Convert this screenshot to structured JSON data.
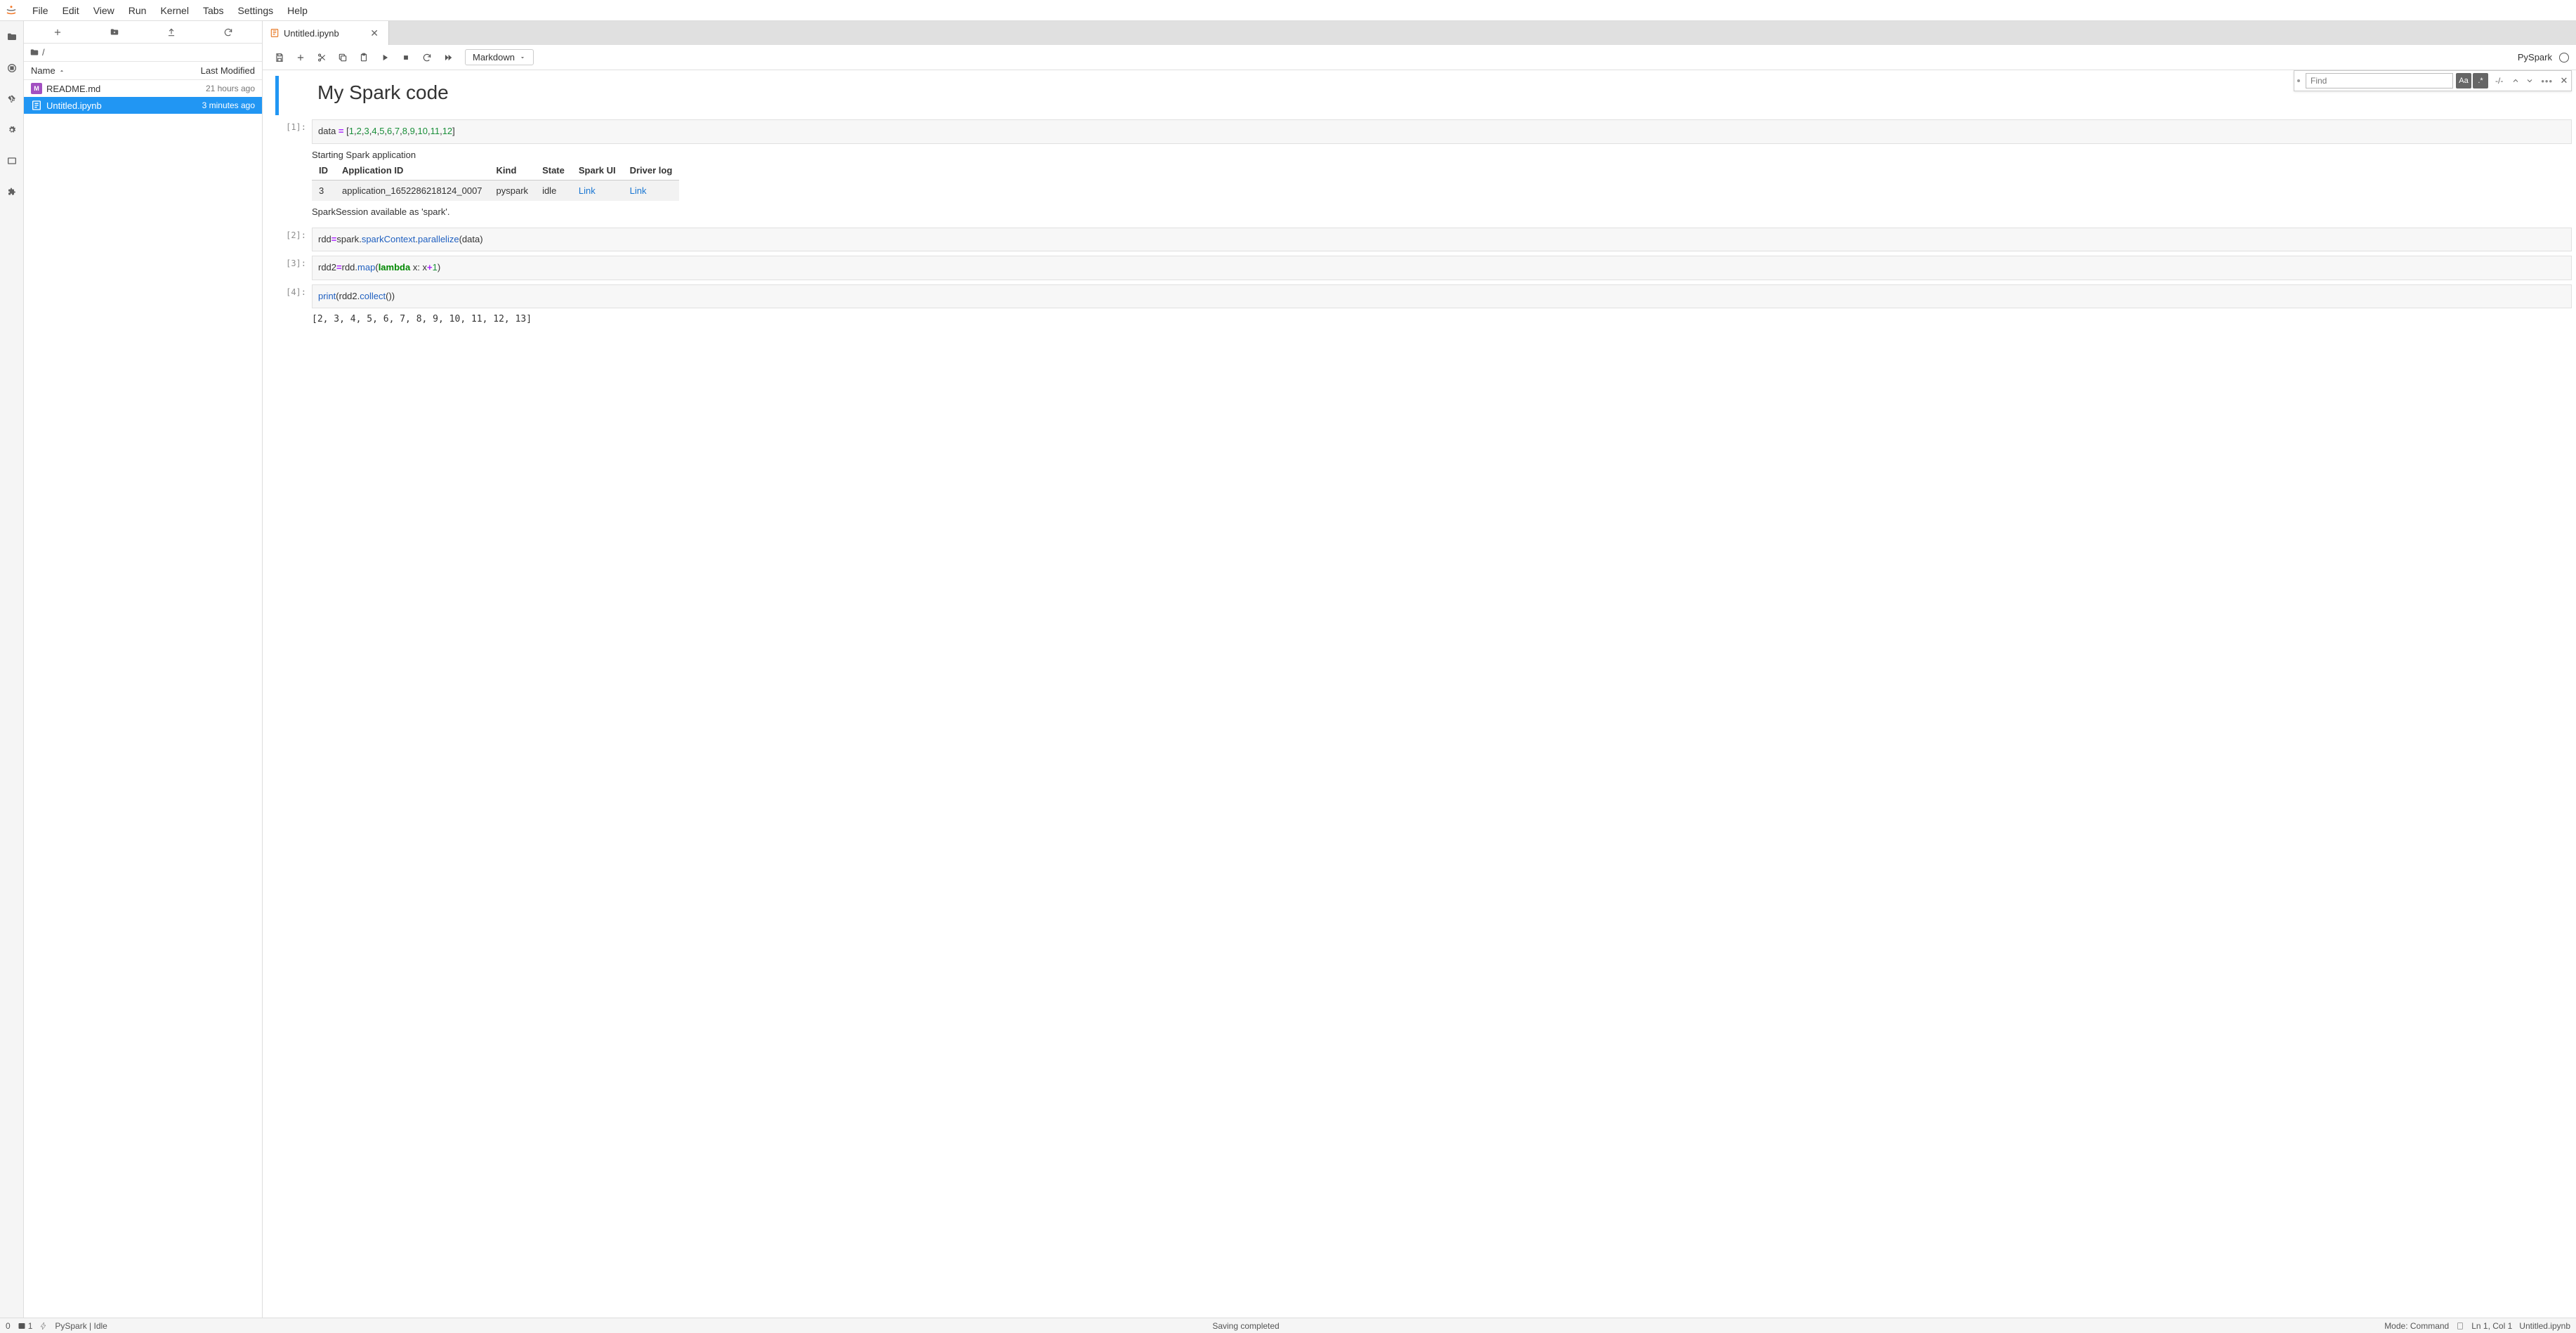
{
  "menu": [
    "File",
    "Edit",
    "View",
    "Run",
    "Kernel",
    "Tabs",
    "Settings",
    "Help"
  ],
  "file_toolbar": {
    "breadcrumb_sep": "/"
  },
  "file_header": {
    "name": "Name",
    "modified": "Last Modified"
  },
  "files": [
    {
      "name": "README.md",
      "modified": "21 hours ago",
      "icon": "md",
      "selected": false,
      "badge": "M"
    },
    {
      "name": "Untitled.ipynb",
      "modified": "3 minutes ago",
      "icon": "nb",
      "selected": true
    }
  ],
  "tab": {
    "title": "Untitled.ipynb"
  },
  "cell_type_selected": "Markdown",
  "kernel": {
    "name": "PySpark"
  },
  "find": {
    "placeholder": "Find",
    "count": "-/-"
  },
  "notebook": {
    "markdown_title": "My Spark code",
    "cells": [
      {
        "prompt": "[1]:",
        "code_tokens": [
          {
            "t": "data ",
            "c": ""
          },
          {
            "t": "=",
            "c": "tk-op"
          },
          {
            "t": " [",
            "c": ""
          },
          {
            "t": "1",
            "c": "tk-num"
          },
          {
            "t": ",",
            "c": ""
          },
          {
            "t": "2",
            "c": "tk-num"
          },
          {
            "t": ",",
            "c": ""
          },
          {
            "t": "3",
            "c": "tk-num"
          },
          {
            "t": ",",
            "c": ""
          },
          {
            "t": "4",
            "c": "tk-num"
          },
          {
            "t": ",",
            "c": ""
          },
          {
            "t": "5",
            "c": "tk-num"
          },
          {
            "t": ",",
            "c": ""
          },
          {
            "t": "6",
            "c": "tk-num"
          },
          {
            "t": ",",
            "c": ""
          },
          {
            "t": "7",
            "c": "tk-num"
          },
          {
            "t": ",",
            "c": ""
          },
          {
            "t": "8",
            "c": "tk-num"
          },
          {
            "t": ",",
            "c": ""
          },
          {
            "t": "9",
            "c": "tk-num"
          },
          {
            "t": ",",
            "c": ""
          },
          {
            "t": "10",
            "c": "tk-num"
          },
          {
            "t": ",",
            "c": ""
          },
          {
            "t": "11",
            "c": "tk-num"
          },
          {
            "t": ",",
            "c": ""
          },
          {
            "t": "12",
            "c": "tk-num"
          },
          {
            "t": "]",
            "c": ""
          }
        ],
        "output_text1": "Starting Spark application",
        "table_headers": [
          "ID",
          "Application ID",
          "Kind",
          "State",
          "Spark UI",
          "Driver log"
        ],
        "table_row": [
          "3",
          "application_1652286218124_0007",
          "pyspark",
          "idle",
          "Link",
          "Link"
        ],
        "output_text2": "SparkSession available as 'spark'."
      },
      {
        "prompt": "[2]:",
        "code_tokens": [
          {
            "t": "rdd",
            "c": ""
          },
          {
            "t": "=",
            "c": "tk-op"
          },
          {
            "t": "spark",
            "c": ""
          },
          {
            "t": ".",
            "c": ""
          },
          {
            "t": "sparkContext",
            "c": "tk-attr"
          },
          {
            "t": ".",
            "c": ""
          },
          {
            "t": "parallelize",
            "c": "tk-attr"
          },
          {
            "t": "(data)",
            "c": ""
          }
        ]
      },
      {
        "prompt": "[3]:",
        "code_tokens": [
          {
            "t": "rdd2",
            "c": ""
          },
          {
            "t": "=",
            "c": "tk-op"
          },
          {
            "t": "rdd",
            "c": ""
          },
          {
            "t": ".",
            "c": ""
          },
          {
            "t": "map",
            "c": "tk-attr"
          },
          {
            "t": "(",
            "c": ""
          },
          {
            "t": "lambda",
            "c": "tk-kw"
          },
          {
            "t": " x: x",
            "c": ""
          },
          {
            "t": "+",
            "c": "tk-op"
          },
          {
            "t": "1",
            "c": "tk-num"
          },
          {
            "t": ")",
            "c": ""
          }
        ]
      },
      {
        "prompt": "[4]:",
        "code_tokens": [
          {
            "t": "print",
            "c": "tk-builtin"
          },
          {
            "t": "(rdd2",
            "c": ""
          },
          {
            "t": ".",
            "c": ""
          },
          {
            "t": "collect",
            "c": "tk-attr"
          },
          {
            "t": "())",
            "c": ""
          }
        ],
        "output_plain": "[2, 3, 4, 5, 6, 7, 8, 9, 10, 11, 12, 13]"
      }
    ]
  },
  "status": {
    "left_count": "1",
    "kernel": "PySpark | Idle",
    "save": "Saving completed",
    "mode": "Mode: Command",
    "pos": "Ln 1, Col 1",
    "file": "Untitled.ipynb"
  }
}
